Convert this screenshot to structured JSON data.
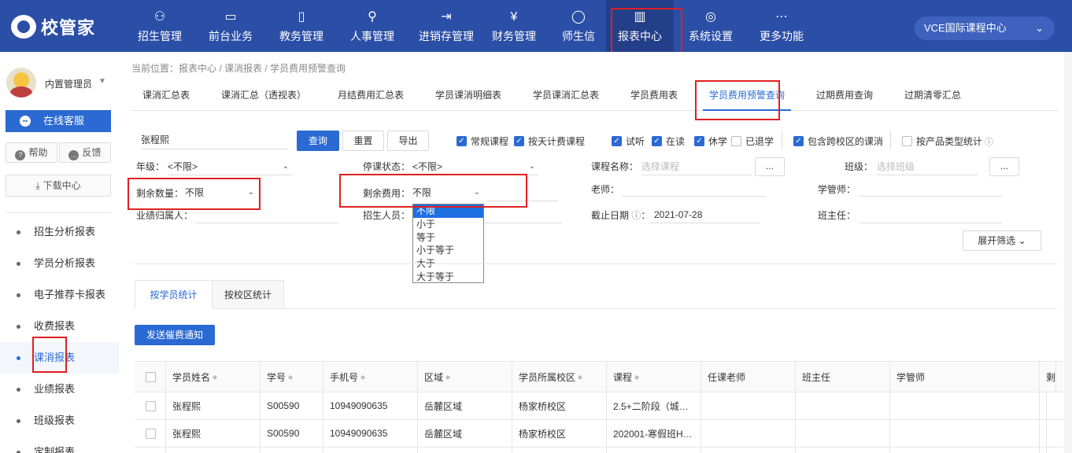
{
  "brand": {
    "name": "校管家"
  },
  "nav": [
    {
      "label": "招生管理",
      "icon": "user-add-icon",
      "glyph": "⚇"
    },
    {
      "label": "前台业务",
      "icon": "reception-icon",
      "glyph": "▭"
    },
    {
      "label": "教务管理",
      "icon": "book-icon",
      "glyph": "▯"
    },
    {
      "label": "人事管理",
      "icon": "person-icon",
      "glyph": "⚲"
    },
    {
      "label": "进销存管理",
      "icon": "inventory-icon",
      "glyph": "⇥"
    },
    {
      "label": "财务管理",
      "icon": "finance-icon",
      "glyph": "¥"
    },
    {
      "label": "师生信",
      "icon": "message-icon",
      "glyph": "◯"
    },
    {
      "label": "报表中心",
      "icon": "report-icon",
      "glyph": "▥"
    },
    {
      "label": "系统设置",
      "icon": "settings-icon",
      "glyph": "◎"
    },
    {
      "label": "更多功能",
      "icon": "more-icon",
      "glyph": "⋯"
    }
  ],
  "campus": {
    "label": "VCE国际课程中心"
  },
  "user": {
    "name": "内置管理员"
  },
  "sidebar": {
    "service": "在线客服",
    "help": "帮助",
    "feedback": "反馈",
    "download": "下载中心",
    "menu": [
      "招生分析报表",
      "学员分析报表",
      "电子推荐卡报表",
      "收费报表",
      "课消报表",
      "业绩报表",
      "班级报表",
      "定制报表"
    ]
  },
  "breadcrumb": "当前位置：报表中心 / 课消报表 / 学员费用预警查询",
  "tabs": [
    "课消汇总表",
    "课消汇总（透视表）",
    "月结费用汇总表",
    "学员课消明细表",
    "学员课消汇总表",
    "学员费用表",
    "学员费用预警查询",
    "过期费用查询",
    "过期清零汇总"
  ],
  "filters": {
    "search_value": "张程熙",
    "btn_query": "查询",
    "btn_reset": "重置",
    "btn_export": "导出",
    "checks": [
      {
        "label": "常规课程",
        "checked": true
      },
      {
        "label": "按天计费课程",
        "checked": true
      },
      {
        "label": "试听",
        "checked": true
      },
      {
        "label": "在读",
        "checked": true
      },
      {
        "label": "休学",
        "checked": true
      },
      {
        "label": "已退学",
        "checked": false
      },
      {
        "label": "包含跨校区的课消",
        "checked": true
      },
      {
        "label": "按产品类型统计",
        "checked": false
      }
    ],
    "grade_label": "年级：",
    "grade_value": "<不限>",
    "suspend_label": "停课状态：",
    "suspend_value": "<不限>",
    "course_label": "课程名称：",
    "course_placeholder": "选择课程",
    "class_label": "班级：",
    "class_placeholder": "选择班级",
    "browse": "...",
    "remaining_qty_label": "剩余数量：",
    "remaining_qty_value": "不限",
    "remaining_fee_label": "剩余费用：",
    "remaining_fee_value": "不限",
    "teacher_label": "老师：",
    "manager_label": "学管师：",
    "perf_owner_label": "业绩归属人：",
    "recruiter_label": "招生人员：",
    "deadline_label": "截止日期",
    "deadline_value": "2021-07-28",
    "homeroom_label": "班主任：",
    "expand": "展开筛选",
    "dropdown_options": [
      "不限",
      "小于",
      "等于",
      "小于等于",
      "大于",
      "大于等于"
    ]
  },
  "subtabs": [
    "按学员统计",
    "按校区统计"
  ],
  "notify_button": "发送催费通知",
  "table": {
    "columns": [
      "学员姓名",
      "学号",
      "手机号",
      "区域",
      "学员所属校区",
      "课程",
      "任课老师",
      "班主任",
      "学管师",
      "剩"
    ],
    "rows": [
      [
        "张程熙",
        "S00590",
        "10949090635",
        "岳麓区域",
        "杨家桥校区",
        "2.5+二阶段（城…",
        "",
        "",
        "",
        ""
      ],
      [
        "张程熙",
        "S00590",
        "10949090635",
        "岳麓区域",
        "杨家桥校区",
        "202001-寒假班H…",
        "",
        "",
        "",
        ""
      ]
    ]
  }
}
